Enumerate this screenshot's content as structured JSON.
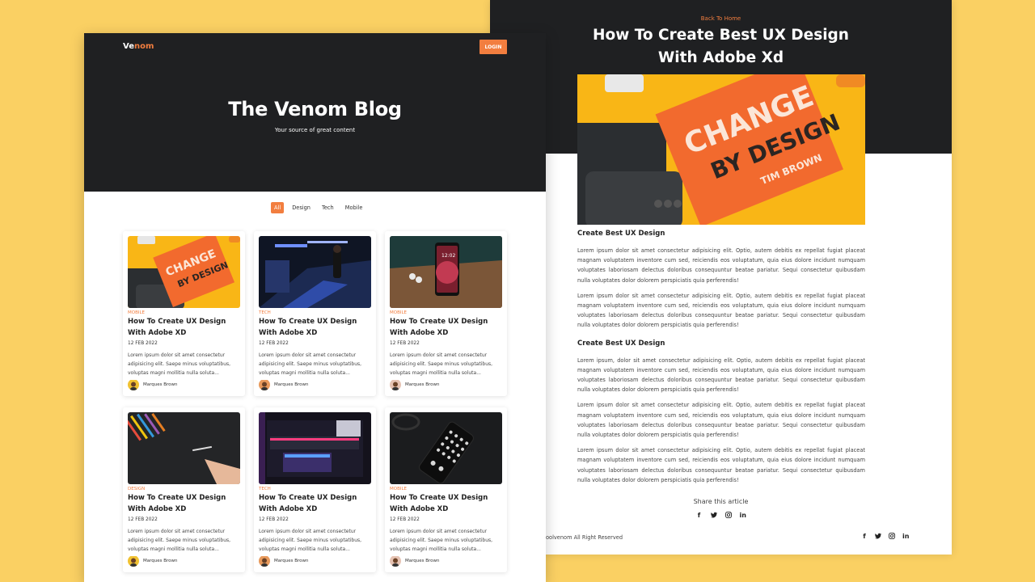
{
  "article": {
    "back_link": "Back To Home",
    "title": "How To Create Best UX Design With Adobe Xd",
    "sections": [
      {
        "heading": "Create Best UX Design",
        "paragraphs": [
          "Lorem ipsum dolor sit amet consectetur adipisicing elit. Optio, autem debitis ex repellat fugiat placeat magnam voluptatem inventore cum sed, reiciendis eos voluptatum, quia eius dolore incidunt numquam voluptates laboriosam delectus doloribus consequuntur beatae pariatur. Sequi consectetur quibusdam nulla voluptates dolor dolorem perspiciatis quia perferendis!",
          "Lorem ipsum dolor sit amet consectetur adipisicing elit. Optio, autem debitis ex repellat fugiat placeat magnam voluptatem inventore cum sed, reiciendis eos voluptatum, quia eius dolore incidunt numquam voluptates laboriosam delectus doloribus consequuntur beatae pariatur. Sequi consectetur quibusdam nulla voluptates dolor dolorem perspiciatis quia perferendis!"
        ]
      },
      {
        "heading": "Create Best UX Design",
        "paragraphs": [
          "Lorem ipsum, dolor sit amet consectetur adipisicing elit. Optio, autem debitis ex repellat fugiat placeat magnam voluptatem inventore cum sed, reiciendis eos voluptatum, quia eius dolore incidunt numquam voluptates laboriosam delectus doloribus consequuntur beatae pariatur. Sequi consectetur quibusdam nulla voluptates dolor dolorem perspiciatis quia perferendis!",
          "Lorem ipsum dolor sit amet consectetur adipisicing elit. Optio, autem debitis ex repellat fugiat placeat magnam voluptatem inventore cum sed, reiciendis eos voluptatum, quia eius dolore incidunt numquam voluptates laboriosam delectus doloribus consequuntur beatae pariatur. Sequi consectetur quibusdam nulla voluptates dolor dolorem perspiciatis quia perferendis!",
          "Lorem ipsum dolor sit amet consectetur adipisicing elit. Optio, autem debitis ex repellat fugiat placeat magnam voluptatem inventore cum sed, reiciendis eos voluptatum, quia eius dolore incidunt numquam voluptates laboriosam delectus doloribus consequuntur beatae pariatur. Sequi consectetur quibusdam nulla voluptates dolor dolorem perspiciatis quia perferendis!"
        ]
      }
    ],
    "share_label": "Share this article",
    "share_icons": [
      "facebook-icon",
      "twitter-icon",
      "instagram-icon",
      "linkedin-icon"
    ],
    "footer_copy": "oolvenom All Right Reserved",
    "hero_book_text": [
      "CHANGE",
      "BY DESIGN",
      "TIM BROWN"
    ]
  },
  "blog": {
    "logo_main": "Ve",
    "logo_accent": "nom",
    "login_label": "LOGIN",
    "title": "The Venom Blog",
    "subtitle": "Your source of great content",
    "filters": [
      "All",
      "Design",
      "Tech",
      "Mobile"
    ],
    "active_filter": "All",
    "cards": [
      {
        "category": "Mobile",
        "title": "How To Create UX Design With Adobe XD",
        "date": "12 FEB 2022",
        "excerpt": "Lorem ipsum dolor sit amet consectetur adipisicing elit. Saepe minus voluptatibus, voluptas magni mollitia nulla soluta...",
        "author": "Marques Brown"
      },
      {
        "category": "Tech",
        "title": "How To Create UX Design With Adobe XD",
        "date": "12 FEB 2022",
        "excerpt": "Lorem ipsum dolor sit amet consectetur adipisicing elit. Saepe minus voluptatibus, voluptas magni mollitia nulla soluta...",
        "author": "Marques Brown"
      },
      {
        "category": "Mobile",
        "title": "How To Create UX Design With Adobe XD",
        "date": "12 FEB 2022",
        "excerpt": "Lorem ipsum dolor sit amet consectetur adipisicing elit. Saepe minus voluptatibus, voluptas magni mollitia nulla soluta...",
        "author": "Marques Brown"
      },
      {
        "category": "Design",
        "title": "How To Create UX Design With Adobe XD",
        "date": "12 FEB 2022",
        "excerpt": "Lorem ipsum dolor sit amet consectetur adipisicing elit. Saepe minus voluptatibus, voluptas magni mollitia nulla soluta...",
        "author": "Marques Brown"
      },
      {
        "category": "Tech",
        "title": "How To Create UX Design With Adobe XD",
        "date": "12 FEB 2022",
        "excerpt": "Lorem ipsum dolor sit amet consectetur adipisicing elit. Saepe minus voluptatibus, voluptas magni mollitia nulla soluta...",
        "author": "Marques Brown"
      },
      {
        "category": "Mobile",
        "title": "How To Create UX Design With Adobe XD",
        "date": "12 FEB 2022",
        "excerpt": "Lorem ipsum dolor sit amet consectetur adipisicing elit. Saepe minus voluptatibus, voluptas magni mollitia nulla soluta...",
        "author": "Marques Brown"
      }
    ],
    "thumb_phone_time": "12:02"
  },
  "colors": {
    "background": "#FAD063",
    "dark": "#1f2022",
    "accent": "#f27e3f"
  }
}
